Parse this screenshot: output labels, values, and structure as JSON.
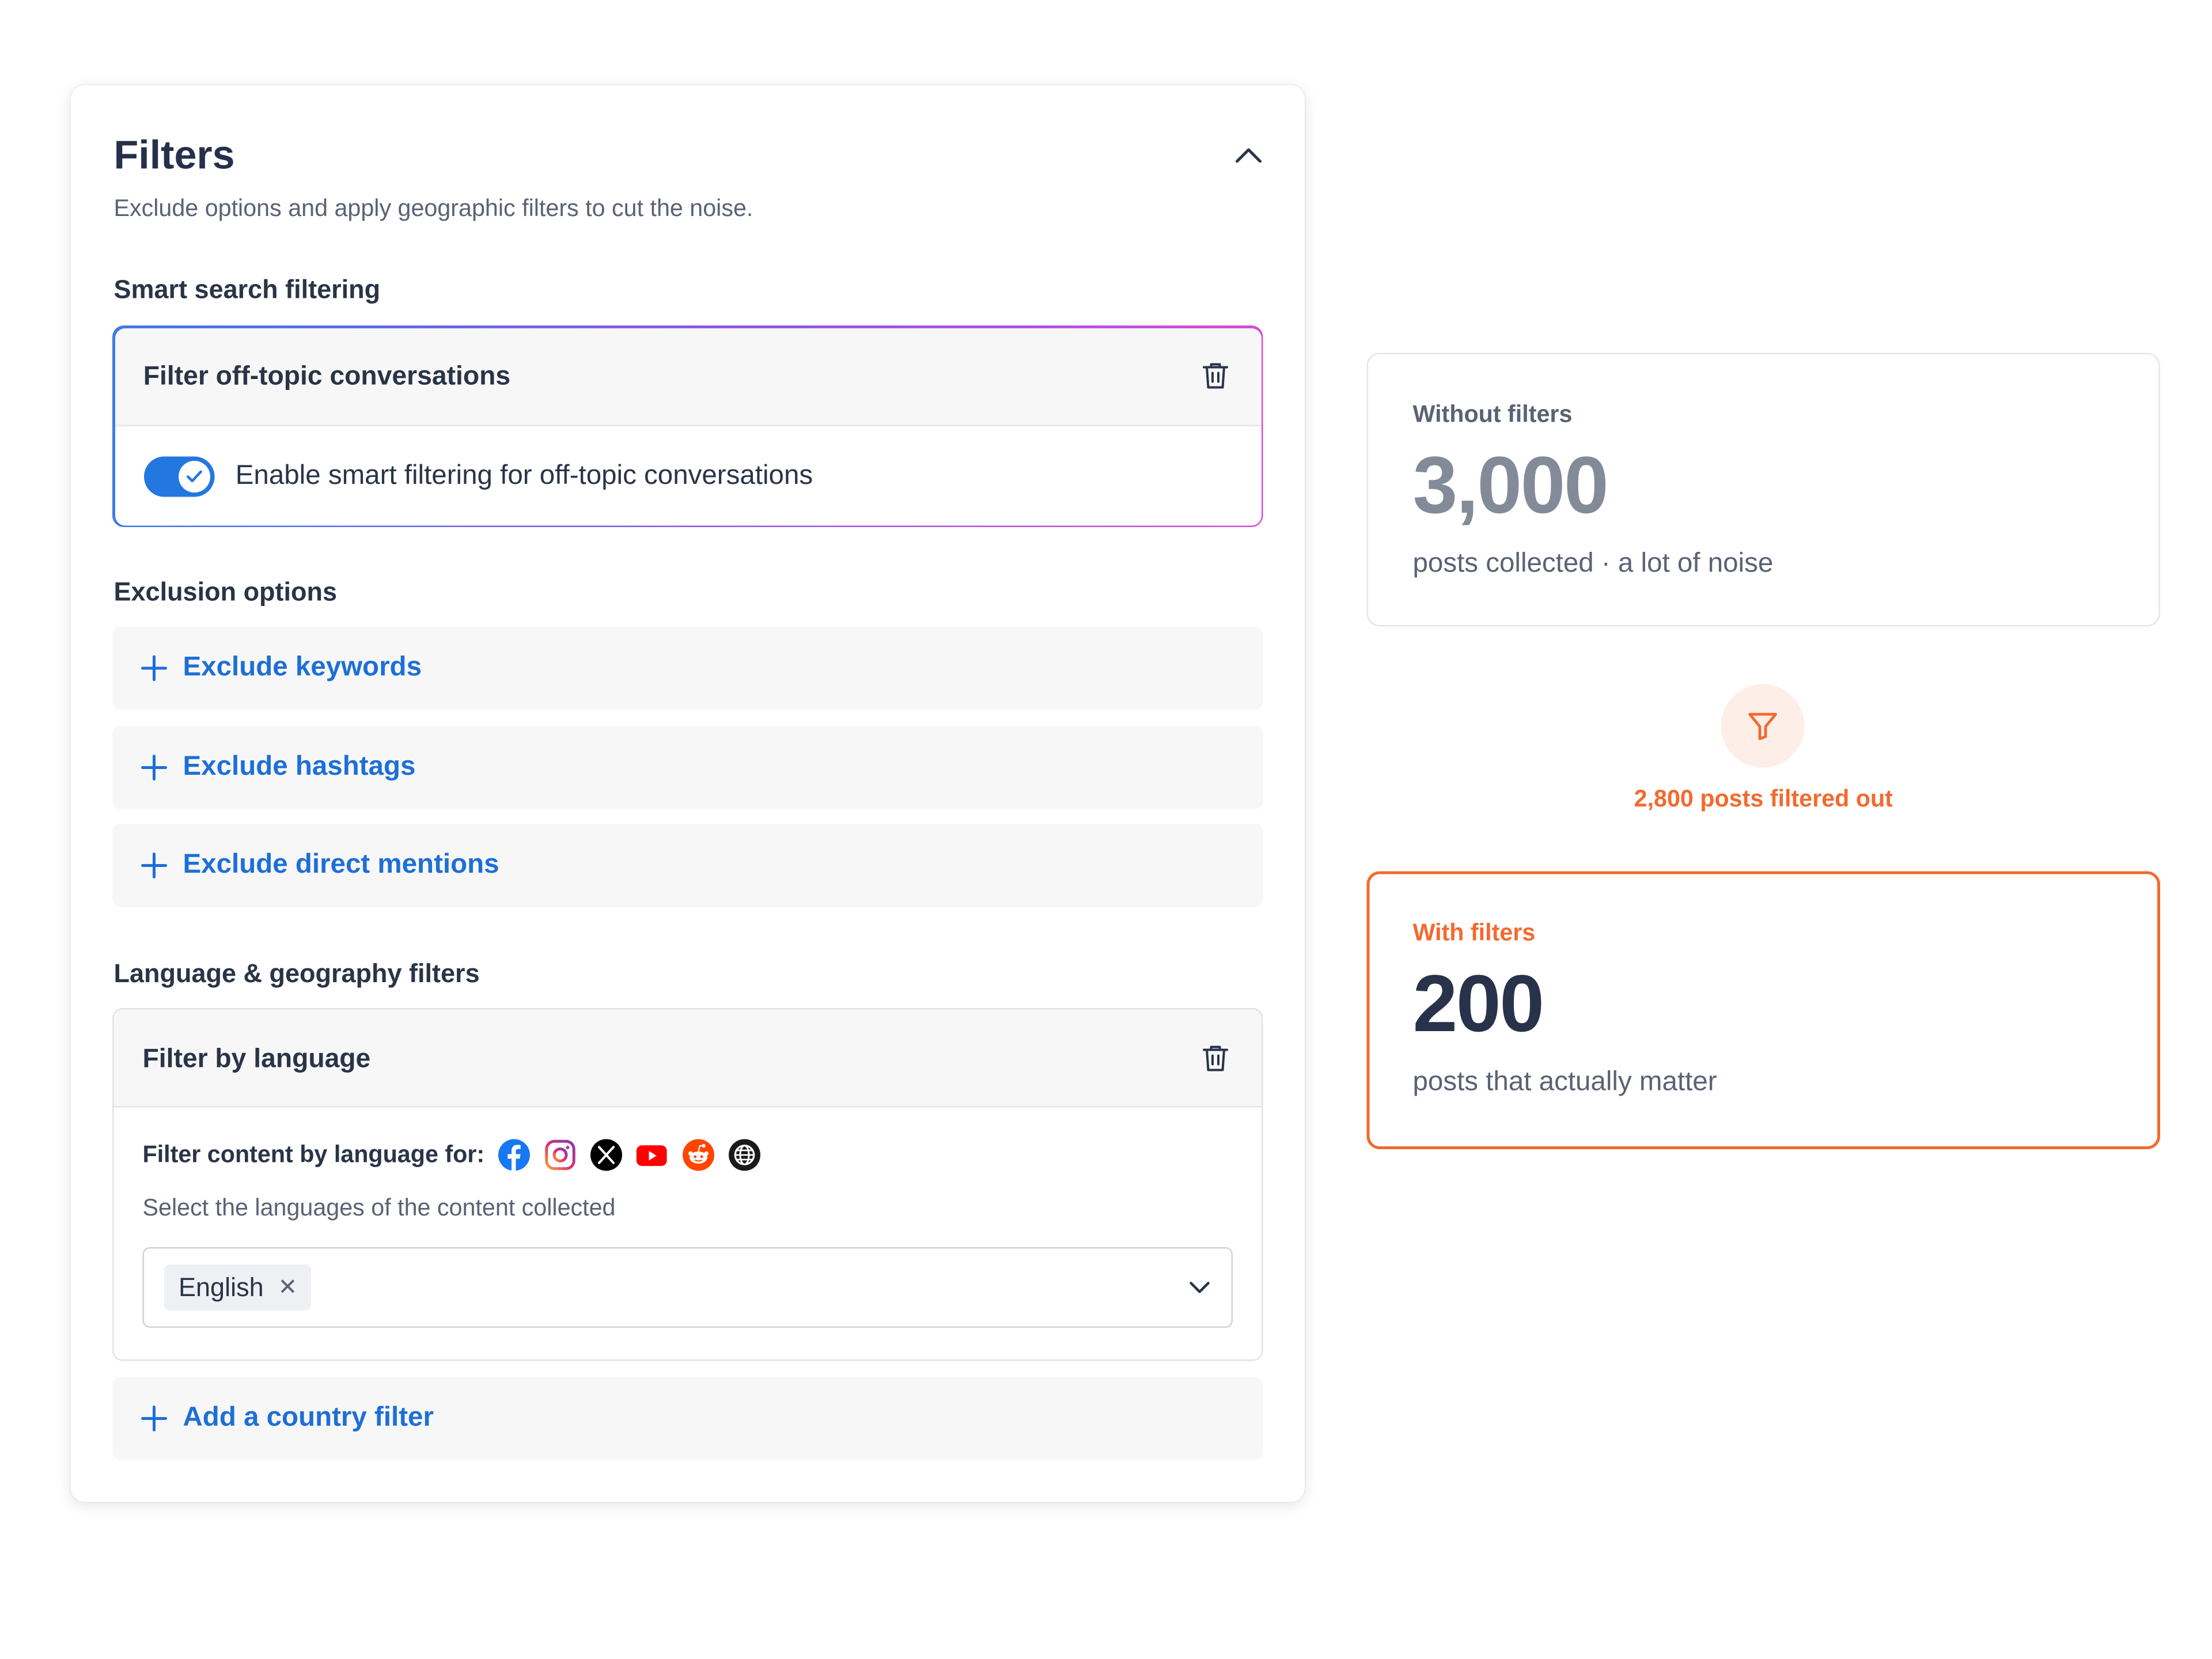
{
  "filters": {
    "title": "Filters",
    "subtitle": "Exclude options and apply geographic filters to cut the noise.",
    "smart_section": {
      "heading": "Smart search filtering",
      "panel_title": "Filter off-topic conversations",
      "toggle_label": "Enable smart filtering for off-topic conversations",
      "toggle_on": true
    },
    "exclusion_section": {
      "heading": "Exclusion options",
      "items": [
        {
          "label": "Exclude keywords"
        },
        {
          "label": "Exclude hashtags"
        },
        {
          "label": "Exclude direct mentions"
        }
      ]
    },
    "geo_section": {
      "heading": "Language & geography filters",
      "language_panel": {
        "title": "Filter by language",
        "for_label": "Filter content by language for:",
        "platform_icons": [
          "facebook-icon",
          "instagram-icon",
          "x-icon",
          "youtube-icon",
          "reddit-icon",
          "web-icon"
        ],
        "hint": "Select the languages of the content collected",
        "selected": [
          "English"
        ]
      },
      "add_country_label": "Add a country filter"
    }
  },
  "stats": {
    "without": {
      "label": "Without filters",
      "value": "3,000",
      "caption": "posts collected · a lot of noise"
    },
    "filtered_out": "2,800 posts filtered out",
    "with": {
      "label": "With filters",
      "value": "200",
      "caption": "posts that actually matter"
    }
  },
  "colors": {
    "accent_blue": "#1d6fd6",
    "accent_orange": "#f26a2e",
    "text_dark": "#2a3447"
  }
}
